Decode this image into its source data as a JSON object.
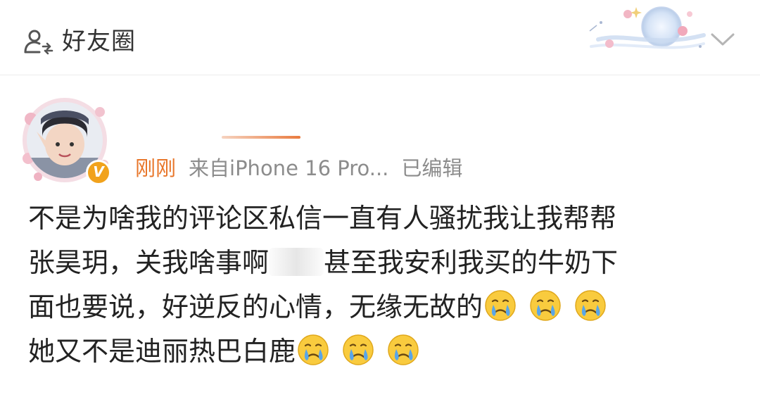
{
  "header": {
    "title": "好友圈",
    "icons": [
      "group-icon",
      "chevron-down-icon"
    ]
  },
  "post": {
    "time": "刚刚",
    "source": "来自iPhone 16 Pro...",
    "edited": "已编辑",
    "verified_badge": "V",
    "badge_color": "#f1a21c",
    "time_color": "#e8762a",
    "content": {
      "line1": "不是为啥我的评论区私信一直有人骚扰我让我帮帮",
      "line2_a": "张昊玥，关我啥事啊",
      "line2_b": "甚至我安利我买的牛奶下",
      "line3": "面也要说，好逆反的心情，无缘无故的",
      "line4": "她又不是迪丽热巴白鹿"
    },
    "emoji": "crying-face-icon"
  }
}
